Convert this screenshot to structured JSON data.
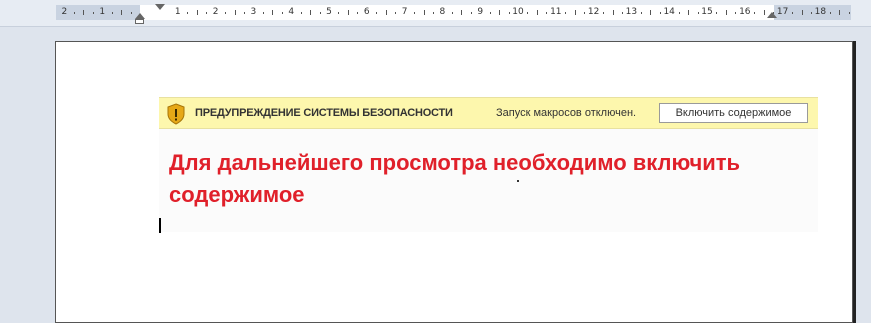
{
  "ruler": {
    "labels": [
      "2",
      "1",
      "1",
      "2",
      "3",
      "4",
      "5",
      "6",
      "7",
      "8",
      "9",
      "10",
      "11",
      "12",
      "13",
      "14",
      "15",
      "16",
      "17",
      "18"
    ]
  },
  "security_bar": {
    "icon": "shield-warning-icon",
    "title": "ПРЕДУПРЕЖДЕНИЕ СИСТЕМЫ БЕЗОПАСНОСТИ",
    "message": "Запуск макросов отключен.",
    "button_label": "Включить содержимое",
    "background_color": "#fdf7ad",
    "icon_color": "#e6a817"
  },
  "document": {
    "instruction_text": "Для дальнейшего просмотра необходимо включить содержимое",
    "instruction_color": "#e0202a"
  }
}
